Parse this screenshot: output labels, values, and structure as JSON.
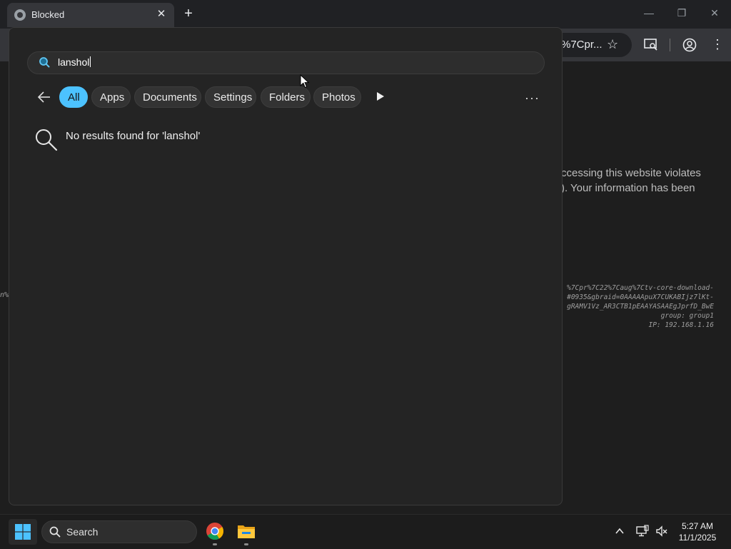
{
  "browser": {
    "tab_title": "Blocked",
    "tab_close": "✕",
    "new_tab": "+",
    "window_controls": {
      "minimize": "—",
      "restore": "❐",
      "close": "✕"
    },
    "url_fragment": "%7Cpr...",
    "star_icon": "☆",
    "kebab": "⋮",
    "page": {
      "message_lines": [
        "ccessing this website violates",
        "). Your information has been"
      ],
      "detail_lines": [
        "%7Cpr%7C22%7Caug%7Ctv-core-download-",
        "#0935&gbraid=0AAAAApuX7CUKABIjz7lKt-",
        "gRAMV1Vz_AR3CTB1pEAAYASAAEgJprfD_BwE",
        "group: group1",
        "IP: 192.168.1.16"
      ],
      "left_fragment": "n%"
    }
  },
  "search_panel": {
    "query": "lanshol",
    "filters": [
      {
        "label": "All",
        "active": true
      },
      {
        "label": "Apps",
        "active": false
      },
      {
        "label": "Documents",
        "active": false
      },
      {
        "label": "Settings",
        "active": false
      },
      {
        "label": "Folders",
        "active": false
      },
      {
        "label": "Photos",
        "active": false
      }
    ],
    "more": "···",
    "no_results_text": "No results found for 'lanshol'"
  },
  "taskbar": {
    "search_label": "Search",
    "time": "5:27 AM",
    "date": "11/1/2025"
  },
  "colors": {
    "accent": "#4cc2ff",
    "panel_bg": "#242424",
    "taskbar_bg": "#1c1c1c"
  }
}
